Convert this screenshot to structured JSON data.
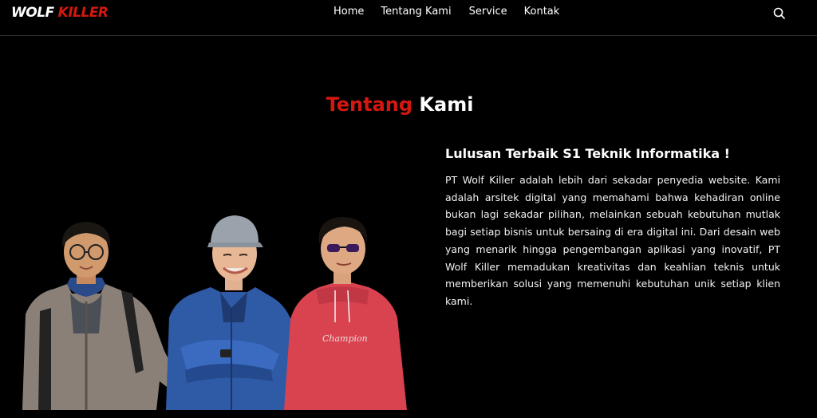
{
  "brand": {
    "part1": "WOLF",
    "part2": "KILLER",
    "primary_color": "#d4180f"
  },
  "nav": {
    "items": [
      "Home",
      "Tentang Kami",
      "Service",
      "Kontak"
    ],
    "search_icon": "search-icon"
  },
  "about": {
    "title_red": "Tentang",
    "title_white": "Kami",
    "heading": "Lulusan Terbaik S1 Teknik Informatika !",
    "body": "PT Wolf Killer adalah lebih dari sekadar penyedia website. Kami adalah arsitek digital yang memahami bahwa kehadiran online bukan lagi sekadar pilihan, melainkan sebuah kebutuhan mutlak bagi setiap bisnis untuk bersaing di era digital ini. Dari desain web yang menarik hingga pengembangan aplikasi yang inovatif, PT Wolf Killer memadukan kreativitas dan keahlian teknis untuk memberikan solusi yang memenuhi kebutuhan unik setiap klien kami."
  },
  "team_photo": {
    "hoodie_text": "Champion"
  }
}
